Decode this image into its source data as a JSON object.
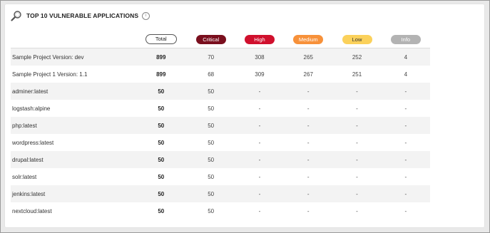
{
  "widget": {
    "title": "TOP 10 VULNERABLE APPLICATIONS",
    "title_icon": "search-icon",
    "info_icon": "info-icon"
  },
  "columns": {
    "total": "Total",
    "critical": "Critical",
    "high": "High",
    "medium": "Medium",
    "low": "Low",
    "info": "Info"
  },
  "colors": {
    "critical": "#7a0f1e",
    "high": "#d0102d",
    "medium": "#f7913a",
    "low": "#fbd15b",
    "info": "#b3b3b3"
  },
  "rows": [
    {
      "name": "Sample Project Version: dev",
      "total": "899",
      "critical": "70",
      "high": "308",
      "medium": "265",
      "low": "252",
      "info": "4"
    },
    {
      "name": "Sample Project 1 Version: 1.1",
      "total": "899",
      "critical": "68",
      "high": "309",
      "medium": "267",
      "low": "251",
      "info": "4"
    },
    {
      "name": "adminer:latest",
      "total": "50",
      "critical": "50",
      "high": "-",
      "medium": "-",
      "low": "-",
      "info": "-"
    },
    {
      "name": "logstash:alpine",
      "total": "50",
      "critical": "50",
      "high": "-",
      "medium": "-",
      "low": "-",
      "info": "-"
    },
    {
      "name": "php:latest",
      "total": "50",
      "critical": "50",
      "high": "-",
      "medium": "-",
      "low": "-",
      "info": "-"
    },
    {
      "name": "wordpress:latest",
      "total": "50",
      "critical": "50",
      "high": "-",
      "medium": "-",
      "low": "-",
      "info": "-"
    },
    {
      "name": "drupal:latest",
      "total": "50",
      "critical": "50",
      "high": "-",
      "medium": "-",
      "low": "-",
      "info": "-"
    },
    {
      "name": "solr:latest",
      "total": "50",
      "critical": "50",
      "high": "-",
      "medium": "-",
      "low": "-",
      "info": "-"
    },
    {
      "name": "jenkins:latest",
      "total": "50",
      "critical": "50",
      "high": "-",
      "medium": "-",
      "low": "-",
      "info": "-"
    },
    {
      "name": "nextcloud:latest",
      "total": "50",
      "critical": "50",
      "high": "-",
      "medium": "-",
      "low": "-",
      "info": "-"
    }
  ]
}
